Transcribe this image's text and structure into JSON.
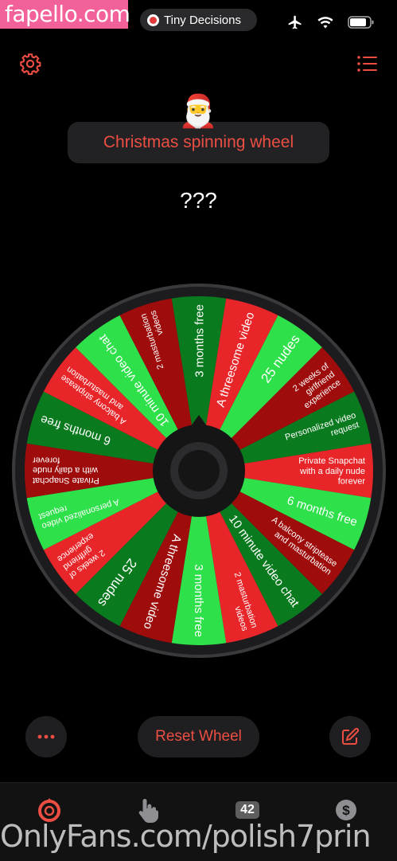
{
  "watermark_top": "fapello.com",
  "watermark_bottom": "OnlyFans.com/polish7prin",
  "status_bar": {
    "app_pill_label": "Tiny Decisions"
  },
  "header": {
    "title": "Christmas spinning wheel",
    "avatar_emoji": "🎅",
    "result": "???"
  },
  "wheel": {
    "colors": [
      "#0a7a1e",
      "#e8262a",
      "#2ee04a",
      "#9e0c0c"
    ],
    "segments": [
      "3 months free",
      "A threesome video",
      "25 nudes",
      "2 weeks of girlfriend experience",
      "Personalized video request",
      "Private Snapchat with a daily nude forever",
      "6 months free",
      "A balcony striptease and masturbation",
      "10 minute video chat",
      "2 masturbation videos",
      "3 months free",
      "A threesome video",
      "25 nudes",
      "2 weeks of girlfriend experience",
      "A personalized video request",
      "Private Snapchat with a daily nude forever",
      "6 months free",
      "A balcony striptease and masturbation",
      "10 minute video chat",
      "2 masturbation videos"
    ]
  },
  "controls": {
    "reset_label": "Reset Wheel",
    "more_icon": "ellipsis-icon",
    "edit_icon": "edit-icon"
  },
  "tabbar": {
    "badge_count": "42",
    "tabs": [
      "wheel-icon",
      "tap-hand-icon",
      "counter-icon",
      "dollar-icon"
    ]
  }
}
